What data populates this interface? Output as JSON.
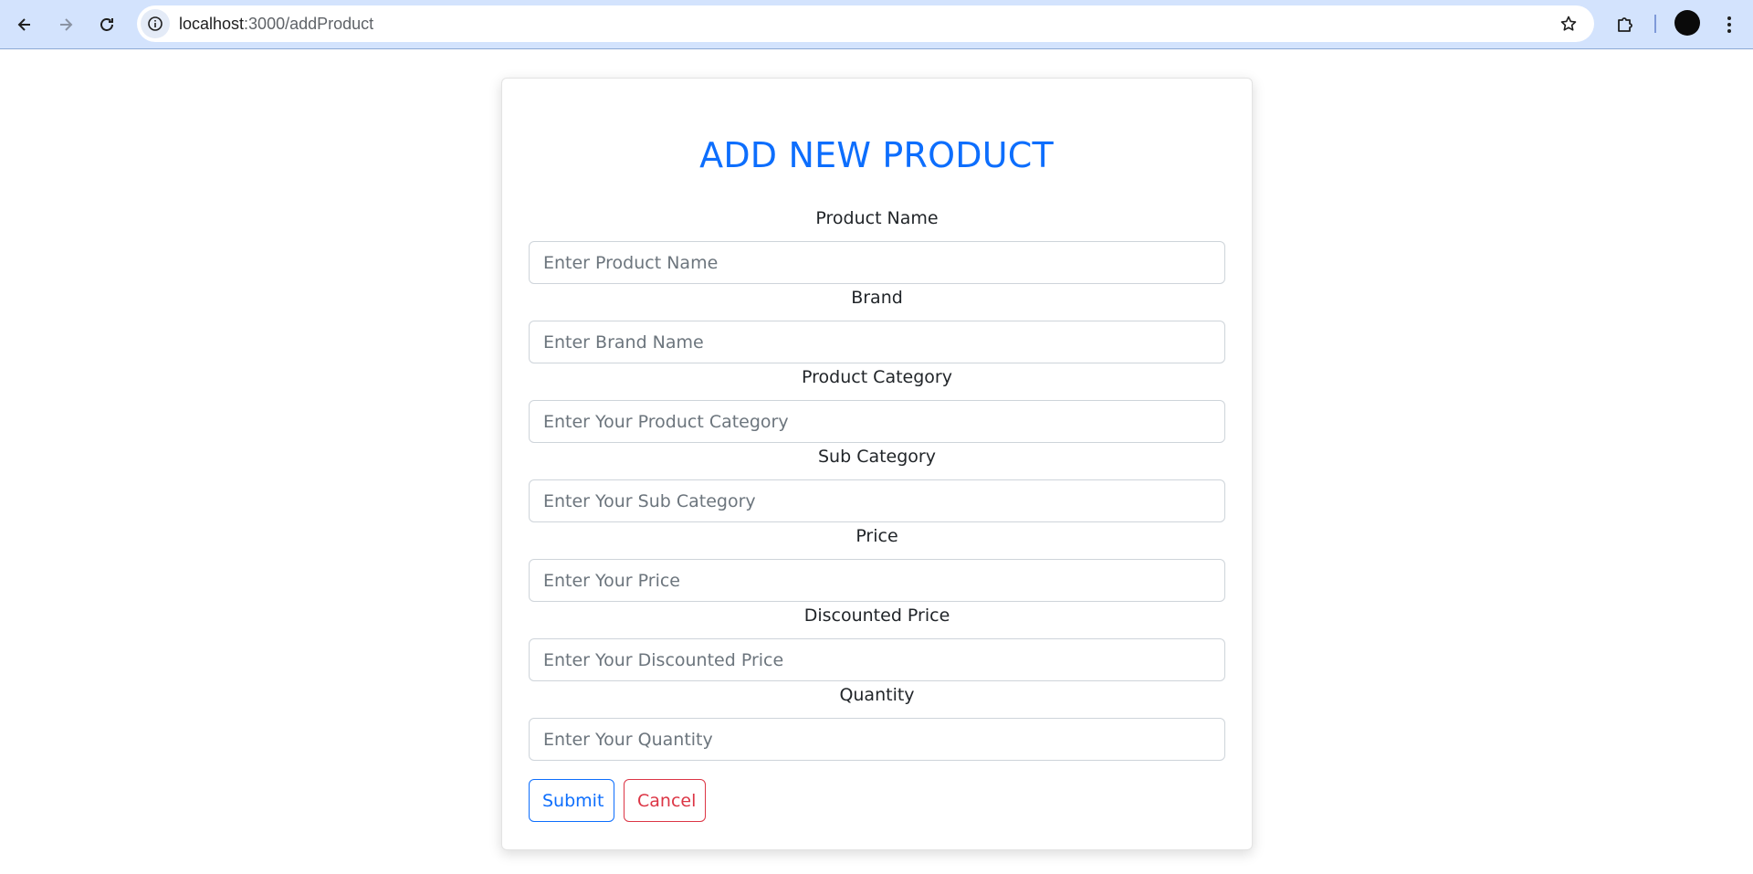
{
  "browser": {
    "url_host": "localhost",
    "url_path": ":3000/addProduct"
  },
  "form": {
    "title": "ADD NEW PRODUCT",
    "fields": [
      {
        "label": "Product Name",
        "placeholder": "Enter Product Name"
      },
      {
        "label": "Brand",
        "placeholder": "Enter Brand Name"
      },
      {
        "label": "Product Category",
        "placeholder": "Enter Your Product Category"
      },
      {
        "label": "Sub Category",
        "placeholder": "Enter Your Sub Category"
      },
      {
        "label": "Price",
        "placeholder": "Enter Your Price"
      },
      {
        "label": "Discounted Price",
        "placeholder": "Enter Your Discounted Price"
      },
      {
        "label": "Quantity",
        "placeholder": "Enter Your Quantity"
      }
    ],
    "submit_label": "Submit",
    "cancel_label": "Cancel"
  },
  "colors": {
    "primary": "#0d6efd",
    "danger": "#dc3545",
    "browser_toolbar": "#d3e3fd"
  },
  "icons": {
    "back": "back-arrow-icon",
    "forward": "forward-arrow-icon",
    "reload": "reload-icon",
    "site_info": "info-icon",
    "bookmark": "star-icon",
    "extensions": "puzzle-icon",
    "profile": "avatar",
    "menu": "kebab-menu-icon"
  }
}
